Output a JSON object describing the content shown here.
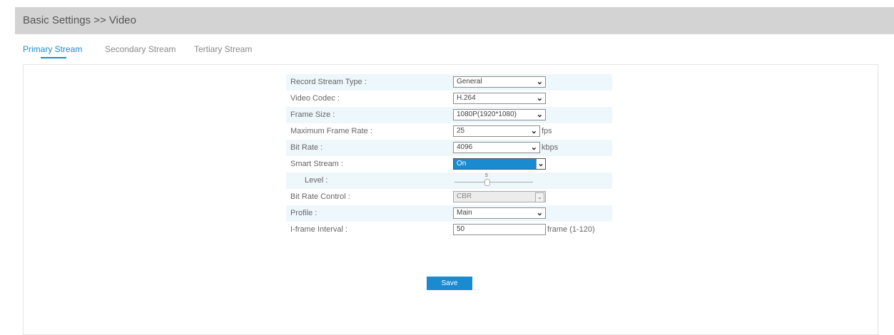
{
  "header": {
    "title": "Basic Settings >> Video"
  },
  "tabs": [
    {
      "label": "Primary Stream",
      "active": true
    },
    {
      "label": "Secondary Stream",
      "active": false
    },
    {
      "label": "Tertiary Stream",
      "active": false
    }
  ],
  "form": {
    "record_stream_type": {
      "label": "Record Stream Type :",
      "value": "General"
    },
    "video_codec": {
      "label": "Video Codec :",
      "value": "H.264"
    },
    "frame_size": {
      "label": "Frame Size :",
      "value": "1080P(1920*1080)"
    },
    "max_frame_rate": {
      "label": "Maximum Frame Rate :",
      "value": "25",
      "unit": "fps"
    },
    "bit_rate": {
      "label": "Bit Rate :",
      "value": "4096",
      "unit": "kbps"
    },
    "smart_stream": {
      "label": "Smart Stream :",
      "value": "On"
    },
    "level": {
      "label": "Level :",
      "value": "5"
    },
    "bit_rate_control": {
      "label": "Bit Rate Control :",
      "value": "CBR"
    },
    "profile": {
      "label": "Profile :",
      "value": "Main"
    },
    "iframe_interval": {
      "label": "I-frame Interval :",
      "value": "50",
      "unit": "frame (1-120)"
    }
  },
  "actions": {
    "save_label": "Save"
  },
  "colors": {
    "accent": "#1a8bd0",
    "header_bg": "#d3d3d3",
    "row_alt": "#eef7fc"
  }
}
